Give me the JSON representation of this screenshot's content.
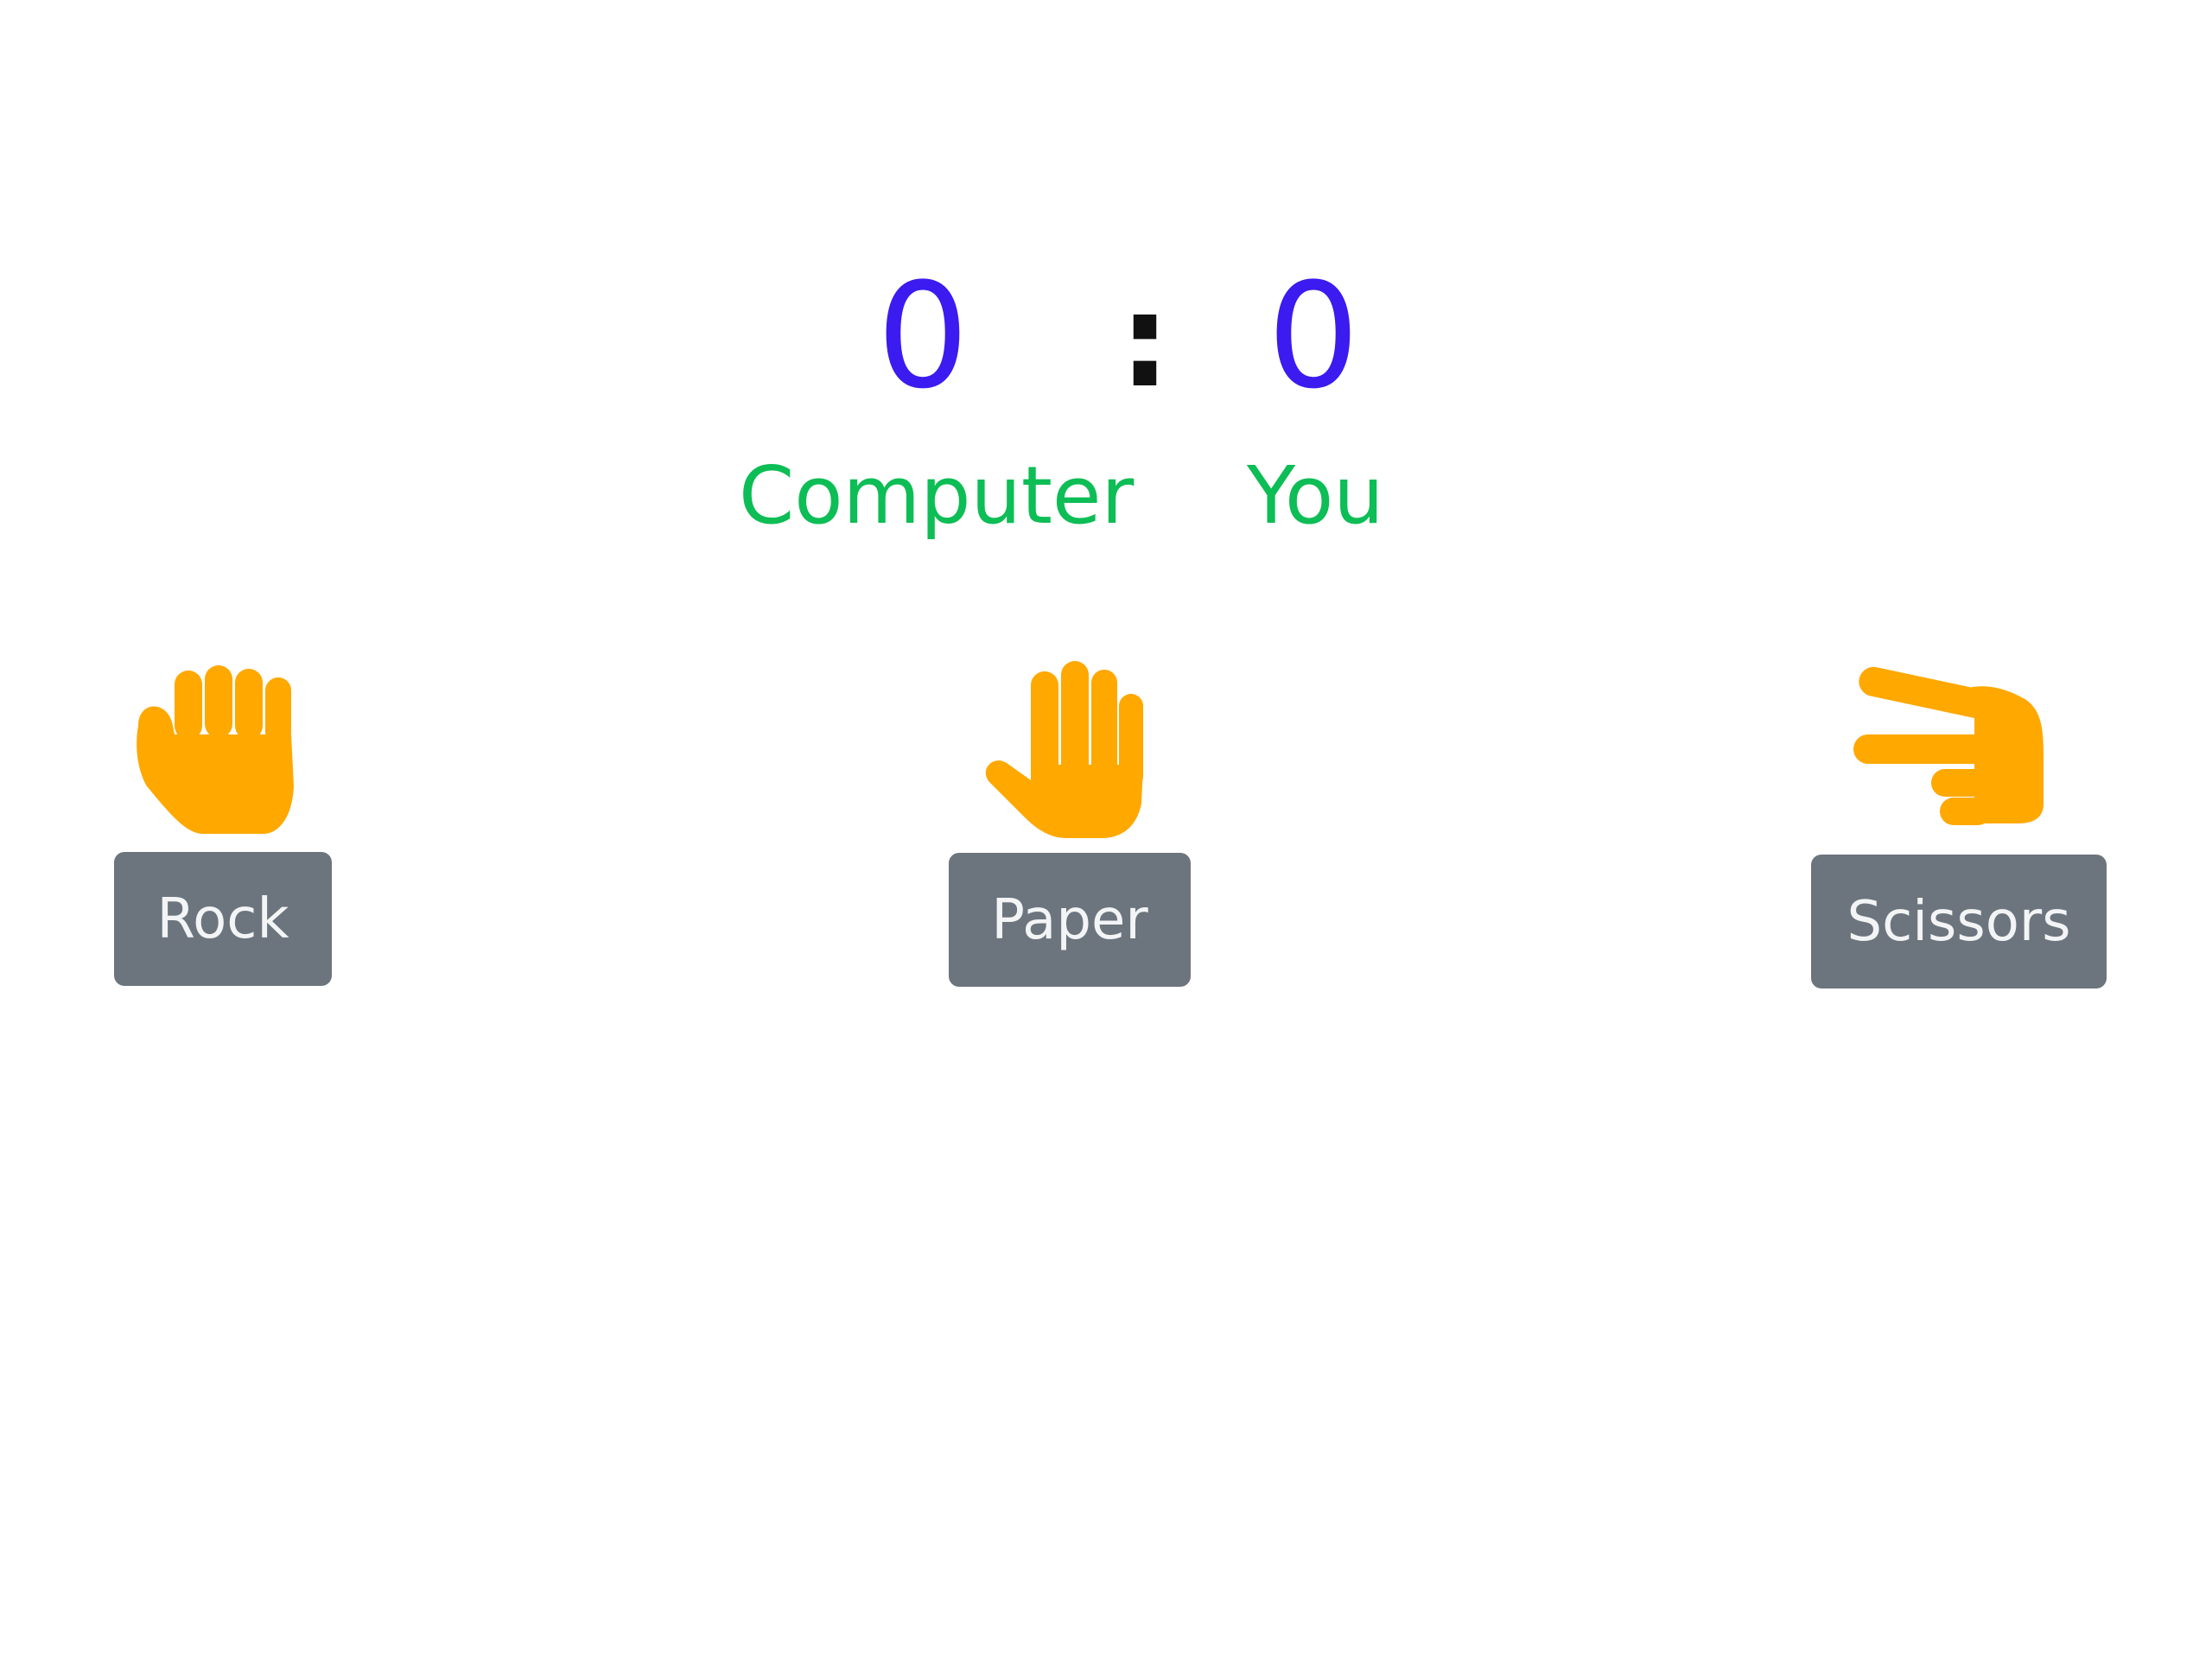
{
  "scoreboard": {
    "computer_score": "0",
    "separator": ":",
    "you_score": "0",
    "computer_label": "Computer",
    "you_label": "You"
  },
  "choices": [
    {
      "label": "Rock",
      "icon": "raised-fist-hand-icon"
    },
    {
      "label": "Paper",
      "icon": "raised-palm-hand-icon"
    },
    {
      "label": "Scissors",
      "icon": "pointing-two-fingers-hand-icon"
    }
  ],
  "colors": {
    "score": "#3b1bf0",
    "player_label": "#0dbd55",
    "hand_icon": "#ffa800",
    "button_bg": "#6c757d",
    "button_text": "#f2f4f6"
  }
}
